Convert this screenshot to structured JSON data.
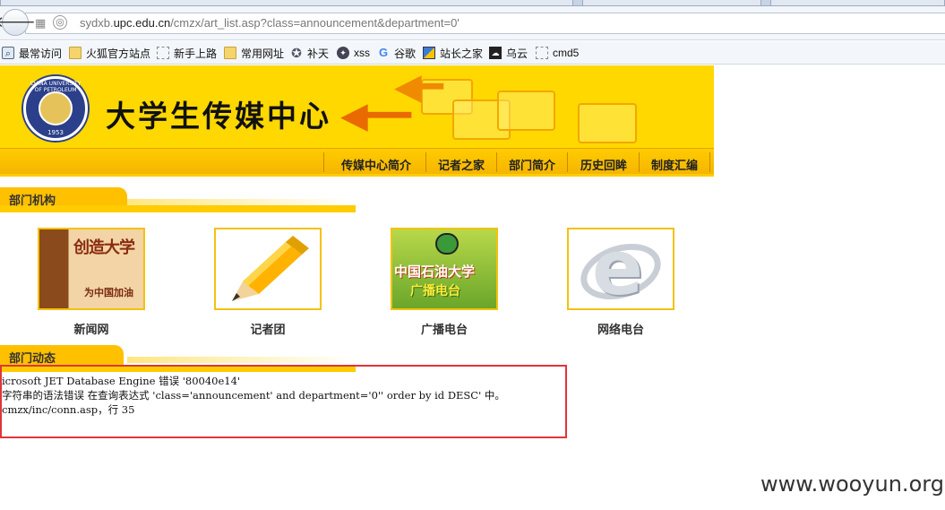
{
  "browser": {
    "url_plain": "sydxb.",
    "url_domain": "upc.edu.cn",
    "url_path": "/cmzx/art_list.asp?class=announcement&department=0'",
    "back_icon": "back-arrow-icon",
    "bookmarks": [
      {
        "label": "最常访问",
        "icon": "compass-icon"
      },
      {
        "label": "火狐官方站点",
        "icon": "folder-icon"
      },
      {
        "label": "新手上路",
        "icon": "page-icon"
      },
      {
        "label": "常用网址",
        "icon": "folder-icon"
      },
      {
        "label": "补天",
        "icon": "star-icon"
      },
      {
        "label": "xss",
        "icon": "seal-icon"
      },
      {
        "label": "谷歌",
        "icon": "google-icon"
      },
      {
        "label": "站长之家",
        "icon": "site-icon"
      },
      {
        "label": "乌云",
        "icon": "wooyun-icon"
      },
      {
        "label": "cmd5",
        "icon": "page-icon"
      }
    ]
  },
  "site": {
    "title": "大学生传媒中心",
    "logo_ring_text": "CHINA UNIVERSITY OF PETROLEUM",
    "logo_year": "1953",
    "menu": [
      "传媒中心简介",
      "记者之家",
      "部门简介",
      "历史回眸",
      "制度汇编"
    ],
    "colors": {
      "banner": "#ffd800",
      "accent": "#ffc000",
      "error_border": "#e0353a"
    }
  },
  "sections": {
    "departments_title": "部门机构",
    "news_title": "部门动态"
  },
  "departments": [
    {
      "label": "新闻网",
      "image_text": "创造大学",
      "image_sub": "为中国加油"
    },
    {
      "label": "记者团",
      "image_text": ""
    },
    {
      "label": "广播电台",
      "image_text": "中国石油大学",
      "image_sub": "广播电台"
    },
    {
      "label": "网络电台",
      "image_text": "e"
    }
  ],
  "error": {
    "line1": "icrosoft JET Database Engine 错误 '80040e14'",
    "line2": "字符串的语法错误 在查询表达式 'class='announcement' and department='0'' order by id DESC' 中。",
    "line3": "cmzx/inc/conn.asp，行 35"
  },
  "watermark": "www.wooyun.org"
}
